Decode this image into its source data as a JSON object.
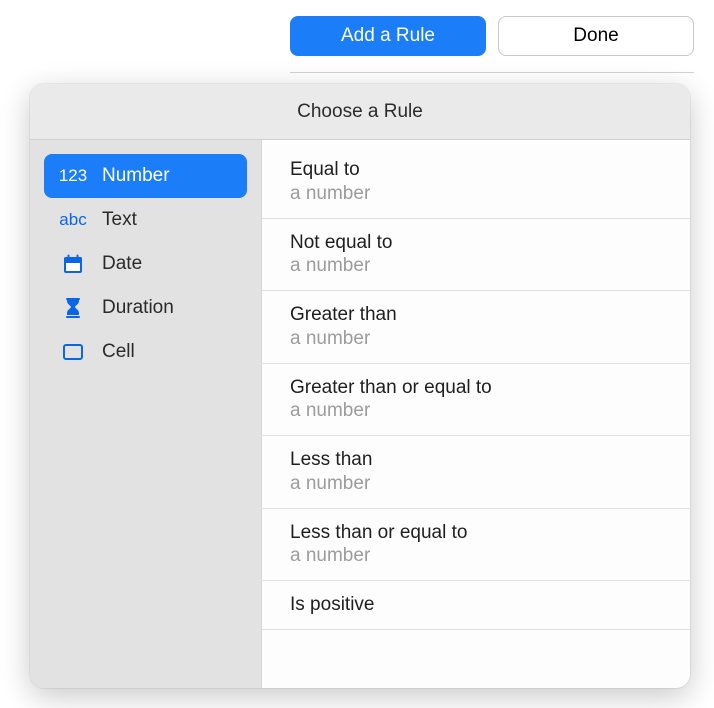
{
  "toolbar": {
    "add_rule_label": "Add a Rule",
    "done_label": "Done"
  },
  "popover": {
    "title": "Choose a Rule"
  },
  "sidebar": {
    "items": [
      {
        "label": "Number",
        "icon": "123"
      },
      {
        "label": "Text",
        "icon": "abc"
      },
      {
        "label": "Date",
        "icon": "calendar"
      },
      {
        "label": "Duration",
        "icon": "hourglass"
      },
      {
        "label": "Cell",
        "icon": "cell"
      }
    ]
  },
  "rules": [
    {
      "title": "Equal to",
      "sub": "a number"
    },
    {
      "title": "Not equal to",
      "sub": "a number"
    },
    {
      "title": "Greater than",
      "sub": "a number"
    },
    {
      "title": "Greater than or equal to",
      "sub": "a number"
    },
    {
      "title": "Less than",
      "sub": "a number"
    },
    {
      "title": "Less than or equal to",
      "sub": "a number"
    },
    {
      "title": "Is positive",
      "sub": ""
    }
  ]
}
